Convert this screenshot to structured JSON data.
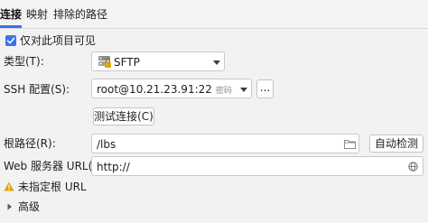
{
  "tabs": [
    {
      "label": "连接",
      "active": true
    },
    {
      "label": "映射",
      "active": false
    },
    {
      "label": "排除的路径",
      "active": false
    }
  ],
  "visible_only_checkbox": {
    "label": "仅对此项目可见",
    "checked": true
  },
  "type_row": {
    "label": "类型(T):",
    "value": "SFTP"
  },
  "ssh_row": {
    "label": "SSH 配置(S):",
    "value": "root@10.21.23.91:22",
    "hint": "密码",
    "more_button": "..."
  },
  "test_connection_button": "测试连接(C)",
  "root_path_row": {
    "label": "根路径(R):",
    "value": "/lbs",
    "autodetect_button": "自动检测"
  },
  "web_url_row": {
    "label": "Web 服务器 URL(W):",
    "value": "http://"
  },
  "warning": {
    "text": "未指定根 URL"
  },
  "advanced": {
    "label": "高级"
  },
  "colors": {
    "accent": "#3574f0",
    "warning": "#e0a30b",
    "background": "#f2f2f2",
    "input_bg": "#ffffff",
    "border": "#c9c9c9"
  },
  "icons": [
    "checkmark-icon",
    "sftp-icon",
    "folder-icon",
    "globe-icon",
    "warning-icon",
    "chevron-right-icon"
  ]
}
